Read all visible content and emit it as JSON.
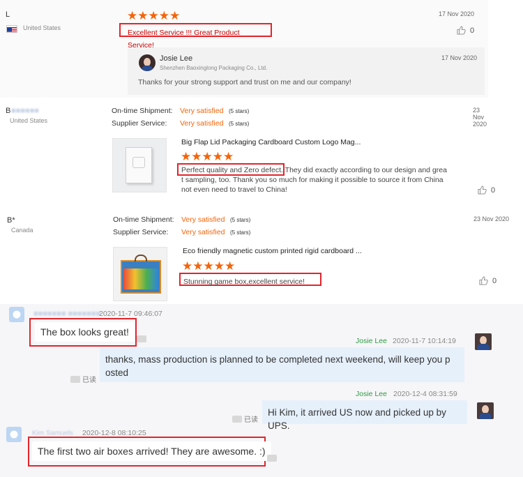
{
  "review1": {
    "user": "L",
    "country": "United States",
    "date": "17 Nov 2020",
    "text": "Excellent Service !!! Great  Product Service!",
    "likes": "0",
    "reply": {
      "name": "Josie Lee",
      "company": "Shenzhen Baoxinglong Packaging Co., Ltd.",
      "date": "17 Nov 2020",
      "text": "Thanks for your strong support and trust on me and our company!"
    }
  },
  "review2": {
    "user": "B",
    "country": "United States",
    "date": "23 Nov 2020",
    "shipment_label": "On-time Shipment:",
    "shipment_value": "Very satisfied",
    "shipment_stars": "(5 stars)",
    "service_label": "Supplier Service:",
    "service_value": "Very satisfied",
    "service_stars": "(5 stars)",
    "product_title": "Big Flap Lid Packaging Cardboard Custom Logo Mag...",
    "text_highlight": "Perfect quality and Zero defect.",
    "text_line1_rest": " They did exactly according to our design and grea",
    "text_line2": "t sampling, too. Thank you so much for making it possible to source it from China",
    "text_line3": "not even need to travel to China!",
    "likes": "0"
  },
  "review3": {
    "user": "B*",
    "country": "Canada",
    "date": "23 Nov 2020",
    "shipment_label": "On-time Shipment:",
    "shipment_value": "Very satisfied",
    "shipment_stars": "(5 stars)",
    "service_label": "Supplier Service:",
    "service_value": "Very satisfied",
    "service_stars": "(5 stars)",
    "product_title": "Eco friendly magnetic custom printed rigid cardboard ...",
    "text": "Stunning game box,excellent service!",
    "likes": "0"
  },
  "chat": {
    "msg1_time": "2020-11-7 09:46:07",
    "msg1_text": "The box looks great!",
    "msg2_name": "Josie Lee",
    "msg2_time": "2020-11-7 10:14:19",
    "msg2_line1": "thanks, mass production is planned to be completed next weekend, will keep you p",
    "msg2_line2": "osted",
    "read_label": "已读",
    "msg3_name": "Josie Lee",
    "msg3_time": "2020-12-4 08:31:59",
    "msg3_text": "Hi Kim, it arrived US now and picked up by UPS.",
    "msg4_sender": "Kim Samuels",
    "msg4_time": "2020-12-8 08:10:25",
    "msg4_text": "The first two air boxes arrived! They are awesome. :)"
  },
  "stars": "★★★★★",
  "colors": {
    "accent": "#f46409",
    "highlight": "#e3242b",
    "reply_bg": "#f5f5f5"
  }
}
